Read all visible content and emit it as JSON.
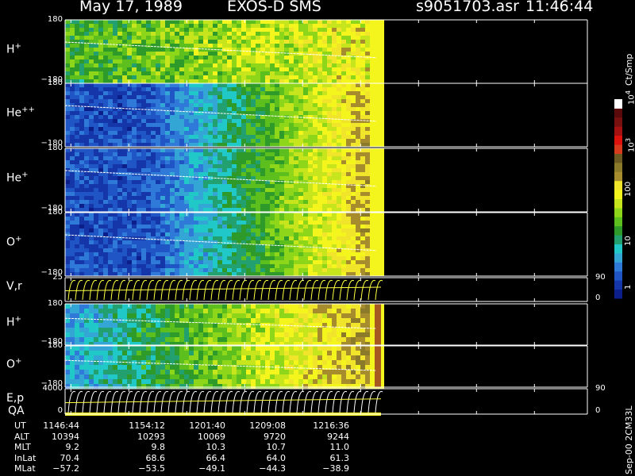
{
  "header": {
    "date": "May 17, 1989",
    "instrument": "EXOS-D SMS",
    "file": "s9051703.asr",
    "time": "11:46:44"
  },
  "colorbar": {
    "unit_label": "Ct/Smp",
    "tick_labels": [
      "1",
      "10",
      "100",
      "10",
      "10"
    ],
    "tick_exponents": [
      "",
      "",
      "",
      "3",
      "4"
    ],
    "colors": [
      "#0b1e8a",
      "#1436a8",
      "#1f55c4",
      "#2f7ad8",
      "#34a6d6",
      "#20c8c8",
      "#22a070",
      "#2d9a2a",
      "#5dbf1e",
      "#8ed61a",
      "#c7e51c",
      "#f5f51e",
      "#f0e52a",
      "#a68c2c",
      "#8a7a2a",
      "#6b5a22",
      "#d83a1e",
      "#e0120e",
      "#a51010",
      "#781010",
      "#5a0a0a",
      "#ffffff"
    ]
  },
  "chart_data": [
    {
      "type": "heatmap",
      "panel": "H+",
      "label": "H",
      "sup": "+",
      "y_range": [
        -180,
        180
      ],
      "tick_labels": [
        "180",
        "−180"
      ]
    },
    {
      "type": "heatmap",
      "panel": "He++",
      "label": "He",
      "sup": "++",
      "y_range": [
        -180,
        180
      ],
      "tick_labels": [
        "180",
        "−180"
      ]
    },
    {
      "type": "heatmap",
      "panel": "He+",
      "label": "He",
      "sup": "+",
      "y_range": [
        -180,
        180
      ],
      "tick_labels": [
        "180",
        "−180"
      ]
    },
    {
      "type": "heatmap",
      "panel": "O+",
      "label": "O",
      "sup": "+",
      "y_range": [
        -180,
        180
      ],
      "tick_labels": [
        "180",
        "−180"
      ]
    },
    {
      "type": "line",
      "panel": "V,r",
      "label": "V,r",
      "sup": "",
      "left_ticks": [
        "25"
      ],
      "right_ticks": [
        "90",
        "0"
      ]
    },
    {
      "type": "heatmap",
      "panel": "H+ (2)",
      "label": "H",
      "sup": "+",
      "y_range": [
        -180,
        180
      ],
      "tick_labels": [
        "180",
        "−180"
      ]
    },
    {
      "type": "heatmap",
      "panel": "O+ (2)",
      "label": "O",
      "sup": "+",
      "y_range": [
        -180,
        180
      ],
      "tick_labels": [
        "180",
        "−180"
      ]
    },
    {
      "type": "line",
      "panel": "E,p",
      "label": "E,p",
      "sup": "",
      "left_ticks": [
        "4000",
        "0"
      ],
      "right_ticks": [
        "90",
        "0"
      ]
    }
  ],
  "qa_label": "QA",
  "orbit_table": {
    "rows": [
      {
        "label": "UT",
        "values": [
          "1146:44",
          "1154:12",
          "1201:40",
          "1209:08",
          "1216:36"
        ]
      },
      {
        "label": "ALT",
        "values": [
          "10394",
          "10293",
          "10069",
          "9720",
          "9244"
        ]
      },
      {
        "label": "MLT",
        "values": [
          "9.2",
          "9.8",
          "10.3",
          "10.7",
          "11.0"
        ]
      },
      {
        "label": "InLat",
        "values": [
          "70.4",
          "68.6",
          "66.4",
          "64.0",
          "61.3"
        ]
      },
      {
        "label": "MLat",
        "values": [
          "−57.2",
          "−53.5",
          "−49.1",
          "−44.3",
          "−38.9"
        ]
      }
    ]
  },
  "footer": "Sep-00 2CM33L"
}
